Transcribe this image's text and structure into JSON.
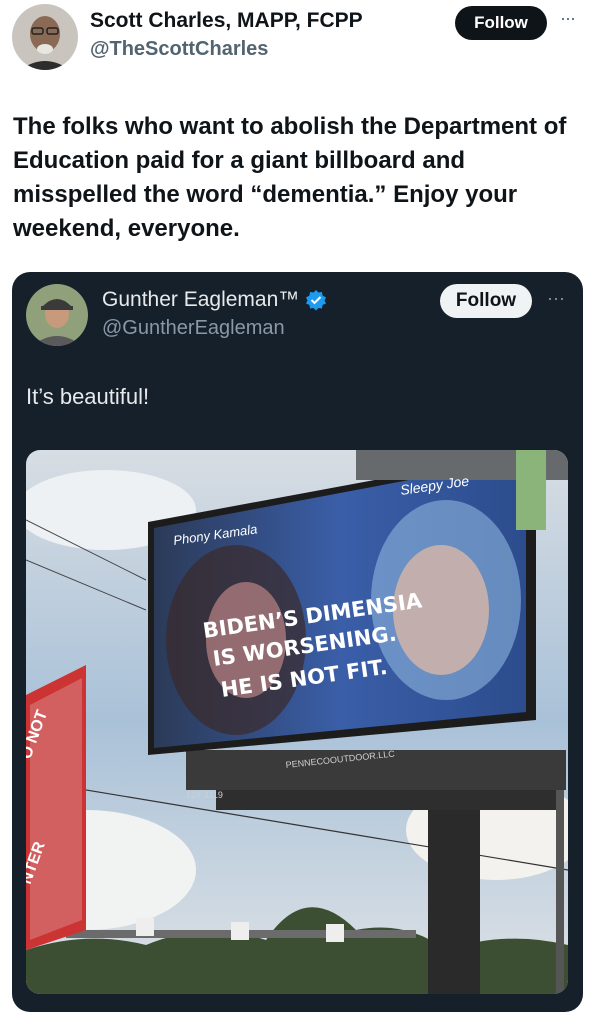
{
  "tweet": {
    "author_name": "Scott Charles, MAPP, FCPP",
    "author_handle": "@TheScottCharles",
    "follow_label": "Follow",
    "more_glyph": "···",
    "text": "The folks who want to abolish the Department of Education paid for a giant billboard and misspelled the word “dementia.” Enjoy your weekend, everyone."
  },
  "quoted_tweet": {
    "author_name": "Gunther Eagleman™",
    "author_handle": "@GuntherEagleman",
    "follow_label": "Follow",
    "more_glyph": "···",
    "text": "It’s beautiful!",
    "verified": true,
    "photo": {
      "billboard_left_label": "Phony Kamala",
      "billboard_right_label": "Sleepy Joe",
      "billboard_line1": "BIDEN’S DIMENSIA",
      "billboard_line2": "IS WORSENING.",
      "billboard_line3": "HE IS NOT FIT.",
      "billboard_company": "PENNECOOUTDOOR.LLC",
      "billboard_id": "12# 3119",
      "sign_text_top": "O NOT",
      "sign_text_bottom": "NTER"
    }
  },
  "colors": {
    "quote_background": "#15202b",
    "verified_badge": "#1d9bf0",
    "billboard_face": "#2a3d6e"
  }
}
